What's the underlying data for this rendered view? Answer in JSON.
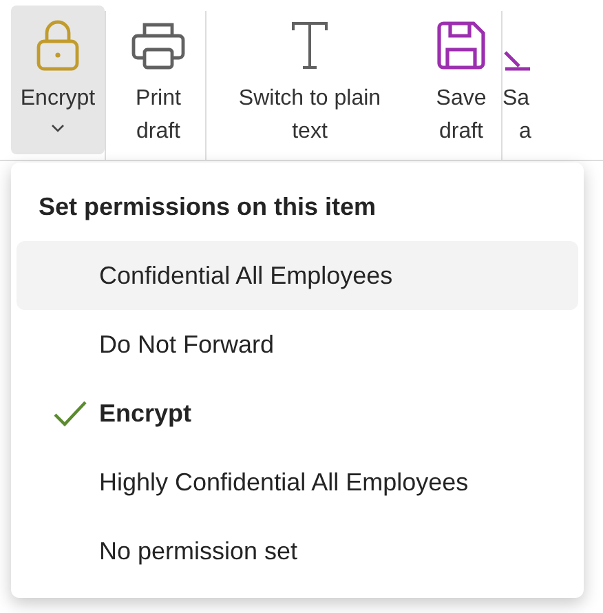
{
  "ribbon": [
    {
      "kind": "lock",
      "lines": [
        "Encrypt"
      ],
      "selected": true,
      "dropdown": true
    },
    {
      "kind": "printer",
      "lines": [
        "Print",
        "draft"
      ],
      "selected": false
    },
    {
      "kind": "text",
      "lines": [
        "Switch to plain",
        "text"
      ],
      "selected": false
    },
    {
      "kind": "save",
      "lines": [
        "Save",
        "draft"
      ],
      "selected": false
    },
    {
      "kind": "download",
      "lines": [
        "Sa",
        "a"
      ],
      "selected": false
    }
  ],
  "menu": {
    "title": "Set permissions on this item",
    "items": [
      {
        "label": "Confidential All Employees",
        "checked": false,
        "selected": true
      },
      {
        "label": "Do Not Forward",
        "checked": false,
        "selected": false
      },
      {
        "label": "Encrypt",
        "checked": true,
        "selected": false
      },
      {
        "label": "Highly Confidential All Employees",
        "checked": false,
        "selected": false
      },
      {
        "label": "No permission set",
        "checked": false,
        "selected": false
      }
    ]
  }
}
